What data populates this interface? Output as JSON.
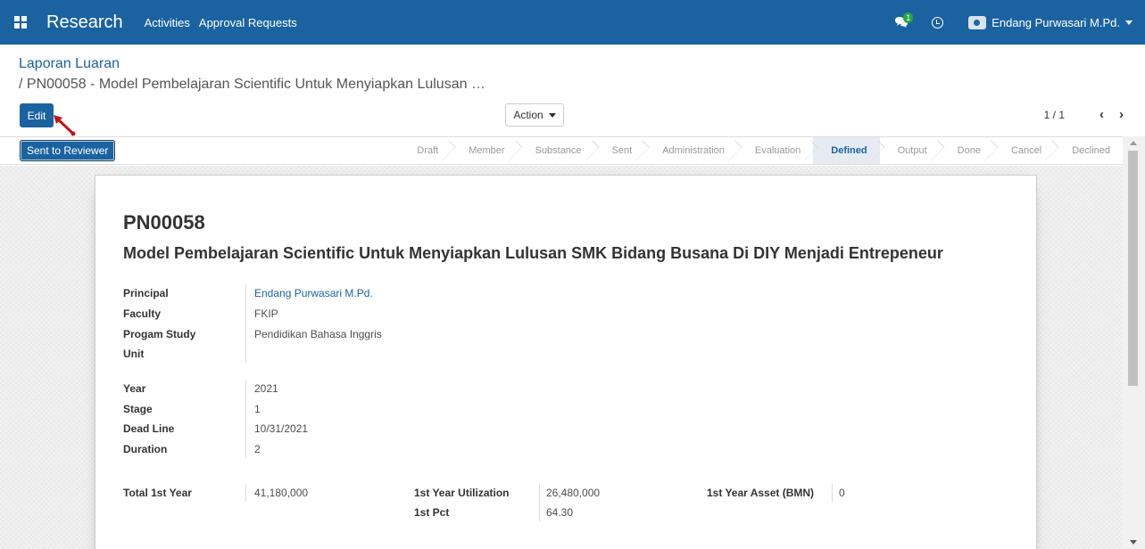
{
  "navbar": {
    "brand": "Research",
    "menu": [
      "Activities",
      "Approval Requests"
    ],
    "chat_badge": "1",
    "user_name": "Endang Purwasari M.Pd."
  },
  "control": {
    "breadcrumb_root": "Laporan Luaran",
    "breadcrumb_current": "/ PN00058 - Model Pembelajaran Scientific Untuk Menyiapkan Lulusan …",
    "edit_label": "Edit",
    "action_label": "Action",
    "pager": "1 / 1",
    "prev": "‹",
    "next": "›"
  },
  "statusbar": {
    "button_label": "Sent to Reviewer",
    "stages": [
      "Draft",
      "Member",
      "Substance",
      "Sent",
      "Administration",
      "Evaluation",
      "Defined",
      "Output",
      "Done",
      "Cancel",
      "Declined"
    ],
    "active_stage": "Defined"
  },
  "record": {
    "reference": "PN00058",
    "title": "Model Pembelajaran Scientific Untuk Menyiapkan Lulusan SMK Bidang Busana Di DIY Menjadi Entrepeneur",
    "group1": [
      {
        "label": "Principal",
        "value": "Endang Purwasari M.Pd."
      },
      {
        "label": "Faculty",
        "value": "FKIP"
      },
      {
        "label": "Progam Study",
        "value": "Pendidikan Bahasa Inggris"
      },
      {
        "label": "Unit",
        "value": ""
      }
    ],
    "group2": [
      {
        "label": "Year",
        "value": "2021"
      },
      {
        "label": "Stage",
        "value": "1"
      },
      {
        "label": "Dead Line",
        "value": "10/31/2021"
      },
      {
        "label": "Duration",
        "value": "2"
      }
    ],
    "total_1st_year": {
      "label": "Total 1st Year",
      "value": "41,180,000"
    },
    "utilization": {
      "label": "1st Year Utilization",
      "value": "26,480,000"
    },
    "pct": {
      "label": "1st Pct",
      "value": "64.30"
    },
    "asset": {
      "label": "1st Year Asset (BMN)",
      "value": "0"
    }
  },
  "colors": {
    "brand": "#1b63a0",
    "annotation_arrow": "#c0141c"
  }
}
